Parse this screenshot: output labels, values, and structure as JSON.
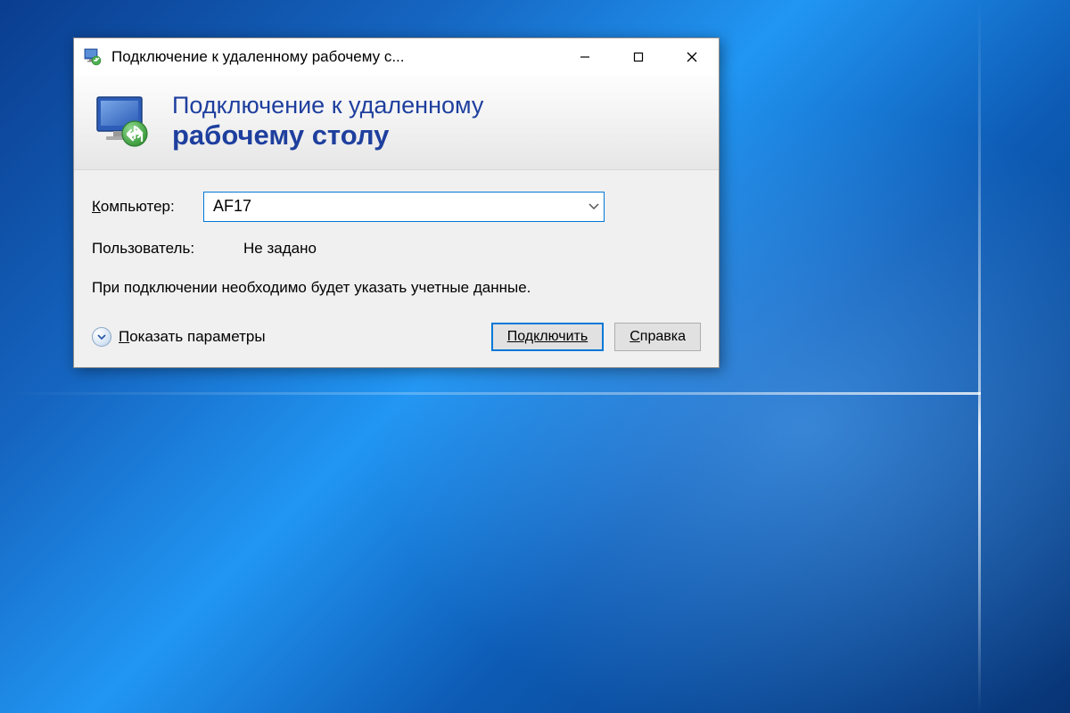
{
  "window": {
    "title": "Подключение к удаленному рабочему с..."
  },
  "banner": {
    "line1": "Подключение к удаленному",
    "line2": "рабочему столу"
  },
  "form": {
    "computer_label_prefix": "К",
    "computer_label_rest": "омпьютер:",
    "computer_value": "AF17",
    "user_label": "Пользователь:",
    "user_value": "Не задано",
    "info": "При подключении необходимо будет указать учетные данные."
  },
  "footer": {
    "show_options_prefix": "П",
    "show_options_rest": "оказать параметры",
    "connect_label": "Подключить",
    "help_prefix": "С",
    "help_rest": "правка"
  }
}
